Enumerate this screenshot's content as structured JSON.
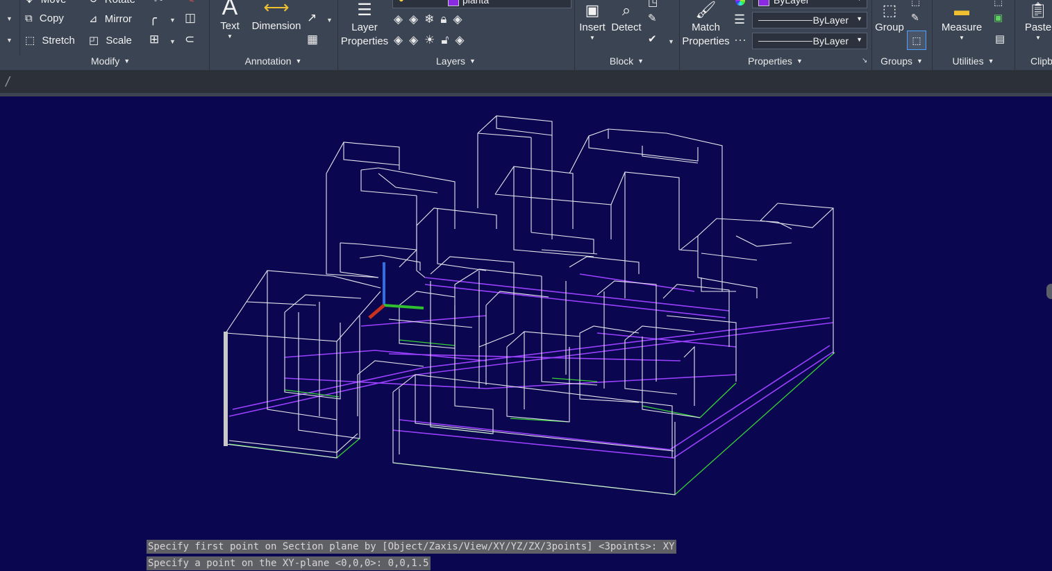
{
  "ribbon": {
    "modify": {
      "label": "Modify",
      "move": "Move",
      "rotate": "Rotate",
      "copy": "Copy",
      "mirror": "Mirror",
      "stretch": "Stretch",
      "scale": "Scale"
    },
    "annotation": {
      "label": "Annotation",
      "text": "Text",
      "dimension": "Dimension"
    },
    "layers": {
      "label": "Layers",
      "layer_properties": "Layer Properties",
      "current_layer": "planta",
      "current_layer_color": "#8a2be2"
    },
    "block": {
      "label": "Block",
      "insert": "Insert",
      "detect": "Detect"
    },
    "properties": {
      "label": "Properties",
      "match_properties": "Match Properties",
      "color_value": "ByLayer",
      "color_swatch": "#8a2be2",
      "linetype_value": "ByLayer",
      "lineweight_value": "ByLayer"
    },
    "groups": {
      "label": "Groups",
      "group": "Group"
    },
    "utilities": {
      "label": "Utilities",
      "measure": "Measure"
    },
    "clipboard": {
      "label": "Clipb",
      "paste": "Paste"
    }
  },
  "command_prompt": "/",
  "command_history": [
    "Specify first point on Section plane by [Object/Zaxis/View/XY/YZ/ZX/3points] <3points>: XY",
    "Specify a point on the XY-plane <0,0,0>: 0,0,1.5"
  ],
  "viewport": {
    "background": "#0b0650",
    "wire_color": "#e8e8f0",
    "section_color": "#9a40ff",
    "base_color": "#34d534",
    "ucs_x_color": "#2fbf2f",
    "ucs_y_color": "#c8321e",
    "ucs_z_color": "#2f6fe0"
  }
}
